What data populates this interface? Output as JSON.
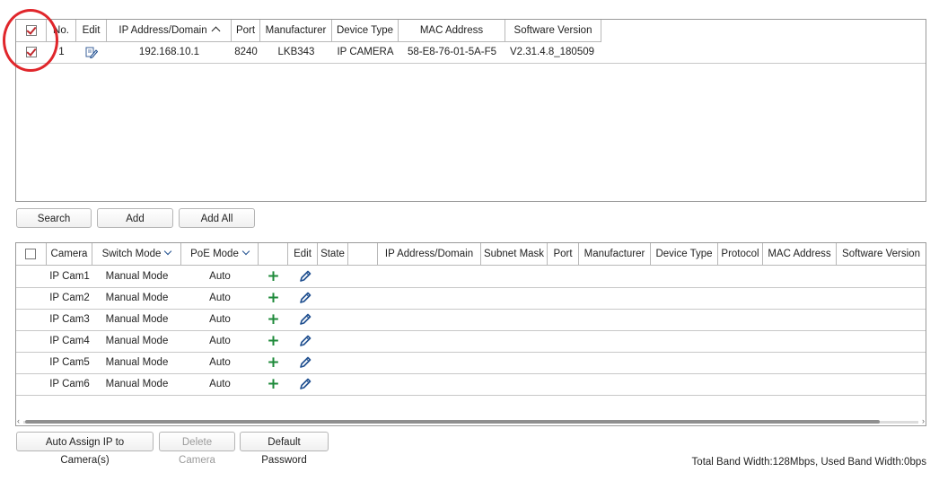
{
  "top_table": {
    "columns": [
      "No.",
      "Edit",
      "IP Address/Domain",
      "Port",
      "Manufacturer",
      "Device Type",
      "MAC Address",
      "Software Version"
    ],
    "rows": [
      {
        "no": "1",
        "ip": "192.168.10.1",
        "port": "8240",
        "manufacturer": "LKB343",
        "device_type": "IP CAMERA",
        "mac": "58-E8-76-01-5A-F5",
        "software": "V2.31.4.8_180509",
        "checked": true
      }
    ]
  },
  "top_buttons": {
    "search": "Search",
    "add": "Add",
    "add_all": "Add All"
  },
  "bottom_table": {
    "columns": [
      "Camera",
      "Switch Mode",
      "PoE Mode",
      "",
      "Edit",
      "State",
      "",
      "IP Address/Domain",
      "Subnet Mask",
      "Port",
      "Manufacturer",
      "Device Type",
      "Protocol",
      "MAC Address",
      "Software Version"
    ],
    "rows": [
      {
        "camera": "IP Cam1",
        "switch_mode": "Manual Mode",
        "poe_mode": "Auto"
      },
      {
        "camera": "IP Cam2",
        "switch_mode": "Manual Mode",
        "poe_mode": "Auto"
      },
      {
        "camera": "IP Cam3",
        "switch_mode": "Manual Mode",
        "poe_mode": "Auto"
      },
      {
        "camera": "IP Cam4",
        "switch_mode": "Manual Mode",
        "poe_mode": "Auto"
      },
      {
        "camera": "IP Cam5",
        "switch_mode": "Manual Mode",
        "poe_mode": "Auto"
      },
      {
        "camera": "IP Cam6",
        "switch_mode": "Manual Mode",
        "poe_mode": "Auto"
      }
    ]
  },
  "bottom_buttons": {
    "auto_assign": "Auto Assign IP to Camera(s)",
    "delete_camera": "Delete Camera",
    "default_password": "Default Password"
  },
  "bandwidth": "Total Band Width:128Mbps, Used Band Width:0bps",
  "colors": {
    "check_mark": "#c0282d",
    "highlight_circle": "#e0262b",
    "add_icon": "#1e8a3a",
    "edit_icon": "#1f4f8f"
  }
}
